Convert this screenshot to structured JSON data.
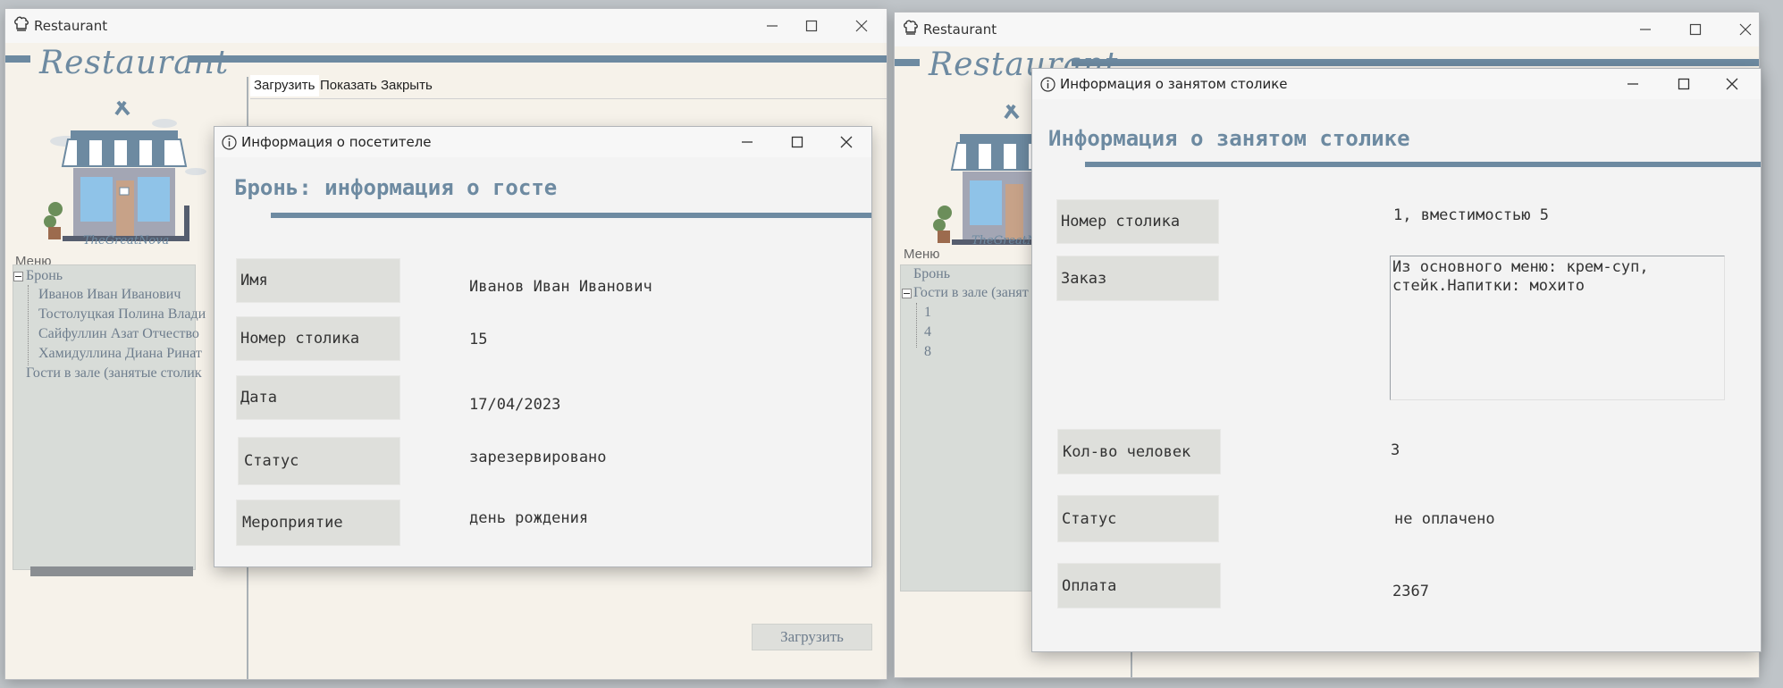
{
  "left_window": {
    "title": "Restaurant",
    "brand": "Restaurant",
    "logo_caption": "TheGreatNova",
    "menu_label": "Меню",
    "tree": {
      "root_booking": "Бронь",
      "guests": [
        "Иванов Иван Иванович",
        "Тостолуцкая Полина Влади",
        "Сайфуллин Азат Отчество",
        "Хамидуллина Диана Ринат"
      ],
      "hall": "Гости в зале (занятые столик"
    },
    "tabs": [
      "Загрузить",
      "Показать",
      "Закрыть"
    ],
    "load_button": "Загрузить"
  },
  "guest_dialog": {
    "title": "Информация о посетителе",
    "heading": "Бронь: информация о госте",
    "fields": [
      {
        "label": "Имя",
        "value": "Иванов  Иван  Иванович"
      },
      {
        "label": "Номер столика",
        "value": "15"
      },
      {
        "label": "Дата",
        "value": "17/04/2023"
      },
      {
        "label": "Статус",
        "value": "зарезервировано"
      },
      {
        "label": "Мероприятие",
        "value": "день рождения"
      }
    ]
  },
  "right_window": {
    "title": "Restaurant",
    "brand": "Restaurant",
    "logo_caption": "TheGreatNova",
    "menu_label": "Меню",
    "tree": {
      "root_booking": "Бронь",
      "hall": "Гости в зале (занят",
      "tables": [
        "1",
        "4",
        "8"
      ]
    }
  },
  "table_dialog": {
    "title": "Информация о занятом столике",
    "heading": "Информация о занятом столике",
    "table_label": "Номер столика",
    "table_value": "1, вместимостью 5",
    "order_label": "Заказ",
    "order_value": "Из основного меню: крем-суп,\nстейк.Напитки: мохито",
    "people_label": "Кол-во человек",
    "people_value": "3",
    "status_label": "Статус",
    "status_value": "не оплачено",
    "payment_label": "Оплата",
    "payment_value": "2367"
  },
  "colors": {
    "accent": "#6d8aa1",
    "tree_bg": "#d8dcd8",
    "field_bg": "#dedfdb"
  }
}
